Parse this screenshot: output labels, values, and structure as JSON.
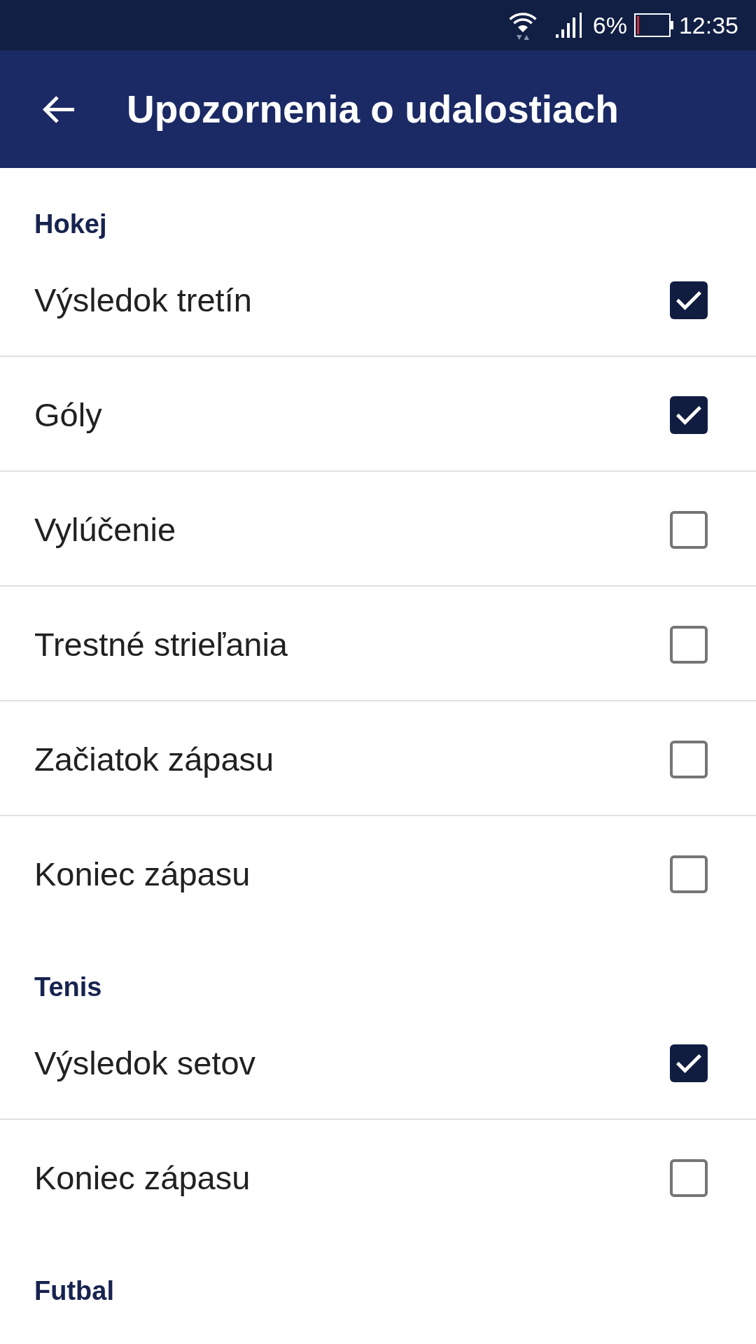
{
  "status_bar": {
    "battery_percent": "6%",
    "time": "12:35"
  },
  "app_bar": {
    "title": "Upozornenia o udalostiach"
  },
  "sections": [
    {
      "title": "Hokej",
      "items": [
        {
          "label": "Výsledok tretín",
          "checked": true
        },
        {
          "label": "Góly",
          "checked": true
        },
        {
          "label": "Vylúčenie",
          "checked": false
        },
        {
          "label": "Trestné strieľania",
          "checked": false
        },
        {
          "label": "Začiatok zápasu",
          "checked": false
        },
        {
          "label": "Koniec zápasu",
          "checked": false
        }
      ]
    },
    {
      "title": "Tenis",
      "items": [
        {
          "label": "Výsledok setov",
          "checked": true
        },
        {
          "label": "Koniec zápasu",
          "checked": false
        }
      ]
    },
    {
      "title": "Futbal"
    }
  ]
}
